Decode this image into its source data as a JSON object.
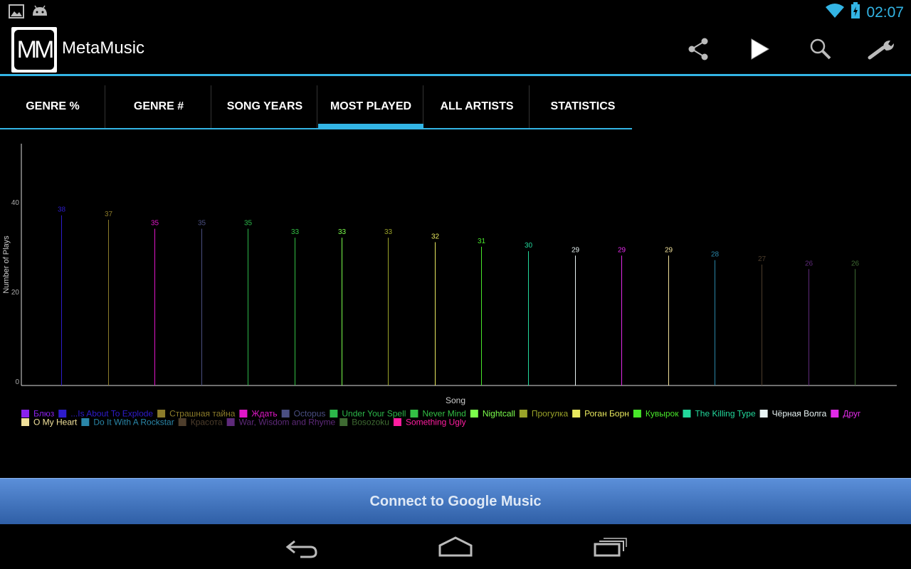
{
  "status": {
    "time": "02:07"
  },
  "app": {
    "title": "MetaMusic",
    "logo_text": "MM"
  },
  "actions": [
    "share-icon",
    "play-icon",
    "search-icon",
    "wrench-icon"
  ],
  "tabs": [
    {
      "label": "GENRE %",
      "selected": false
    },
    {
      "label": "GENRE #",
      "selected": false
    },
    {
      "label": "SONG YEARS",
      "selected": false
    },
    {
      "label": "MOST PLAYED",
      "selected": true
    },
    {
      "label": "ALL ARTISTS",
      "selected": false
    },
    {
      "label": "STATISTICS",
      "selected": false
    }
  ],
  "connect_button": "Connect to Google Music",
  "chart_data": {
    "type": "bar",
    "xlabel": "Song",
    "ylabel": "Number of Plays",
    "ylim": [
      0,
      54
    ],
    "yticks": [
      0,
      20,
      40
    ],
    "grid": false,
    "legend_position": "bottom",
    "categories": [
      "Блюз",
      "...Is About To Explode",
      "Страшная тайна",
      "Ждать",
      "Octopus",
      "Under Your Spell",
      "Never Mind",
      "Nightcall",
      "Прогулка",
      "Роган Борн",
      "Кувырок",
      "The Killing Type",
      "Чёрная Волга",
      "Друг",
      "O My Heart",
      "Do It With A Rockstar",
      "Красота",
      "War, Wisdom and Rhyme",
      "Bosozoku",
      "Something Ugly"
    ],
    "values": [
      38,
      37,
      35,
      35,
      35,
      33,
      33,
      33,
      32,
      31,
      30,
      29,
      29,
      29,
      28,
      27,
      26,
      26
    ],
    "colors": [
      "#8b22ee",
      "#2e1ccc",
      "#8c7c2a",
      "#e017c8",
      "#4a4f82",
      "#2cb74a",
      "#33c045",
      "#7cff4c",
      "#9aa329",
      "#e8e85e",
      "#48e62a",
      "#22d89c",
      "#e8f4f4",
      "#e22ae8",
      "#f0e09a",
      "#2a86a8",
      "#4e3e2c",
      "#5e2a7a",
      "#3e6a32",
      "#ff1ea0"
    ]
  }
}
